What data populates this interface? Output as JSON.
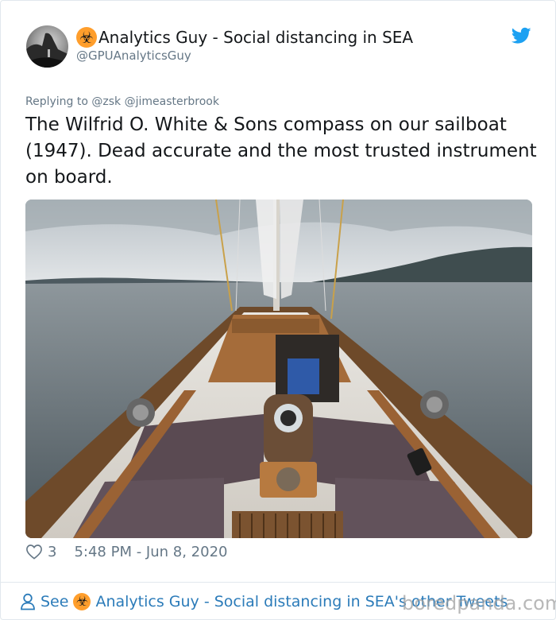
{
  "author": {
    "name_emoji": "☣",
    "name": "Analytics Guy - Social distancing in SEA",
    "handle": "@GPUAnalyticsGuy"
  },
  "reply": {
    "prefix": "Replying to",
    "mentions": "@zsk @jimeasterbrook"
  },
  "tweet": {
    "text": "The Wilfrid O. White & Sons compass on our sailboat (1947). Dead accurate and the most trusted instrument on board."
  },
  "meta": {
    "likes": "3",
    "timestamp": "5:48 PM - Jun 8, 2020"
  },
  "footer": {
    "see_label": "See",
    "see_name": "Analytics Guy - Social distancing in SEA's other Tweets"
  },
  "watermark": "boredpanda.com",
  "icons": {
    "brand": "twitter-bird-icon",
    "like": "heart-icon",
    "person": "person-icon"
  },
  "colors": {
    "link": "#2b7bb9",
    "twitter_blue": "#1da1f2",
    "muted": "#657786",
    "emoji_bg": "#ff9e2c"
  }
}
